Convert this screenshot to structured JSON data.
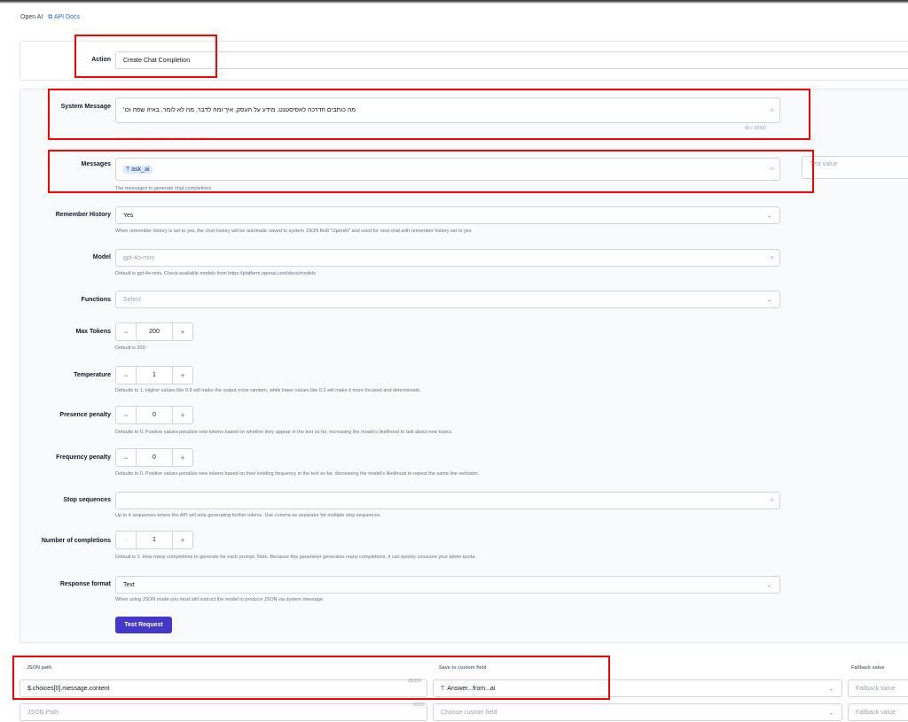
{
  "breadcrumb": {
    "app": "Open AI",
    "docs_link": "API Docs"
  },
  "action": {
    "label": "Action",
    "value": "Create Chat Completion"
  },
  "system_message": {
    "label": "System Message",
    "value": "מה כותבים הדרכה לאסיסטנט, מידע על העסק, איך ומה לדבר, מה לא לומר, באיזו שפה וכו'",
    "counter": "80 / 10000",
    "help": "You can add up to unlimited instruction lines"
  },
  "messages": {
    "label": "Messages",
    "tag": "ask_ai",
    "help": "The messages to generate chat completions",
    "test_value_placeholder": "Test value"
  },
  "remember_history": {
    "label": "Remember History",
    "value": "Yes",
    "help": "When remember history is set to yes, the chat history will be automatic saved to system JSON field \"OpenAI\" and used for next chat with remember history set to yes"
  },
  "model": {
    "label": "Model",
    "placeholder": "gpt-4o-mini",
    "help": "Default is gpt-4o-mini. Check available models from https://platform.openai.com/docs/models"
  },
  "functions": {
    "label": "Functions",
    "placeholder": "Select"
  },
  "max_tokens": {
    "label": "Max Tokens",
    "value": "200",
    "help": "Default is 200"
  },
  "temperature": {
    "label": "Temperature",
    "value": "1",
    "help": "Defaults to 1. Higher values like 0.8 will make the output more random, while lower values like 0.2 will make it more focused and deterministic."
  },
  "presence_penalty": {
    "label": "Presence penalty",
    "value": "0",
    "help": "Defaults to 0. Positive values penalize new tokens based on whether they appear in the text so far, increasing the model's likelihood to talk about new topics."
  },
  "frequency_penalty": {
    "label": "Frequency penalty",
    "value": "0",
    "help": "Defaults to 0. Positive values penalize new tokens based on their existing frequency in the text so far, decreasing the model's likelihood to repeat the same line verbatim."
  },
  "stop_sequences": {
    "label": "Stop sequences",
    "help": "Up to 4 sequences where the API will stop generating further tokens. Use comma as separator for multiple stop sequences."
  },
  "completions": {
    "label": "Number of completions",
    "value": "1",
    "help": "Default is 1. How many completions to generate for each prompt. Note: Because this parameter generates many completions, it can quickly consume your token quota."
  },
  "response_format": {
    "label": "Response format",
    "value": "Text",
    "help": "When using JSON mode you must still instruct the model to produce JSON via system message."
  },
  "test_button": "Test Request",
  "mapping": {
    "headers": {
      "json_path": "JSON path",
      "custom_field": "Save to custom field",
      "fallback": "Fallback value"
    },
    "rows": [
      {
        "path": "$.choices[0].message.content",
        "counter": "28/200",
        "field": "Answer...from...ai",
        "fallback_placeholder": "Fallback value"
      },
      {
        "path_placeholder": "JSON Path",
        "counter": "0/200",
        "field_placeholder": "Choose custom field",
        "fallback_placeholder": "Fallback value"
      }
    ]
  },
  "colors": {
    "accent": "#4338ca",
    "link": "#2563eb",
    "highlight": "#ff0000"
  }
}
